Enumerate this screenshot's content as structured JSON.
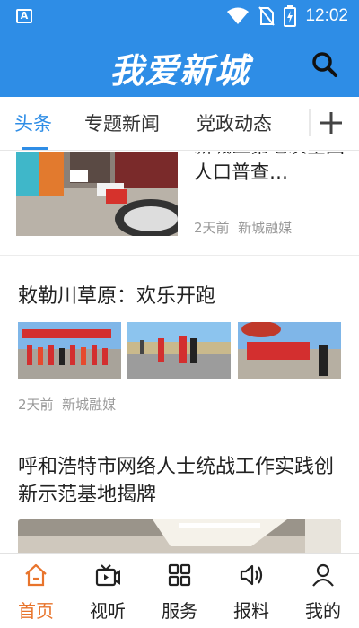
{
  "status_bar": {
    "notification_badge": "A",
    "time": "12:02"
  },
  "header": {
    "title": "我爱新城"
  },
  "tabs": [
    {
      "label": "头条",
      "active": true
    },
    {
      "label": "专题新闻",
      "active": false
    },
    {
      "label": "党政动态",
      "active": false
    }
  ],
  "feed": {
    "items": [
      {
        "title": "新城区第七次全国人口普查…",
        "time": "2天前",
        "source": "新城融媒"
      },
      {
        "title": "敕勒川草原：欢乐开跑",
        "time": "2天前",
        "source": "新城融媒"
      },
      {
        "title": "呼和浩特市网络人士统战工作实践创新示范基地揭牌"
      }
    ]
  },
  "bottom_nav": [
    {
      "label": "首页",
      "icon": "home-icon",
      "active": true
    },
    {
      "label": "视听",
      "icon": "video-icon",
      "active": false
    },
    {
      "label": "服务",
      "icon": "grid-icon",
      "active": false
    },
    {
      "label": "报料",
      "icon": "speaker-icon",
      "active": false
    },
    {
      "label": "我的",
      "icon": "user-icon",
      "active": false
    }
  ],
  "colors": {
    "brand": "#2e8de6",
    "active_nav": "#e8742c",
    "meta_text": "#999999"
  }
}
